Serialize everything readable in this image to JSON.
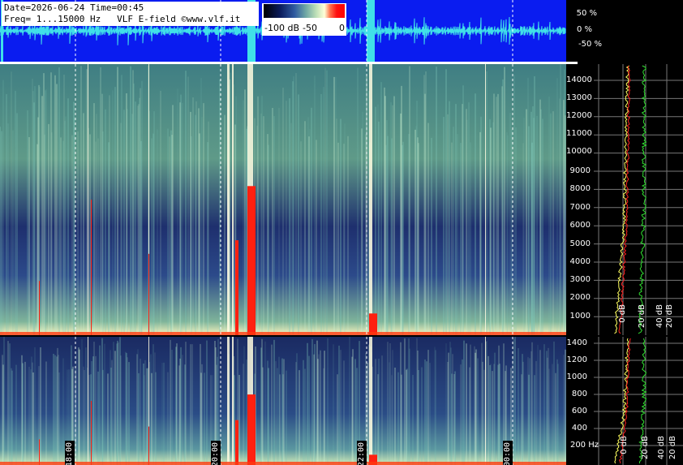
{
  "header": {
    "line1": "Date=2026-06-24 Time=00:45",
    "line2": "Freq= 1...15000 Hz   VLF E-field ©www.vlf.it"
  },
  "colorbar": {
    "labels": [
      "-100 dB",
      "-50",
      "0"
    ]
  },
  "waveform_axis": {
    "labels": [
      "50 %",
      "0 %",
      "-50 %"
    ]
  },
  "spectrogram_top": {
    "freq_labels": [
      "14000",
      "13000",
      "12000",
      "11000",
      "10000",
      "9000",
      "8000",
      "7000",
      "6000",
      "5000",
      "4000",
      "3000",
      "2000",
      "1000"
    ],
    "db_labels": [
      "0 dB",
      "20 dB",
      "40 dB",
      "20 dB"
    ]
  },
  "spectrogram_bottom": {
    "freq_labels": [
      "1400",
      "1200",
      "1000",
      "800",
      "600",
      "400",
      "200 Hz"
    ],
    "db_labels": [
      "0 dB",
      "20 dB",
      "40 dB",
      "20 dB"
    ]
  },
  "time_marks": [
    "18:00",
    "20:00",
    "22:00",
    "00:00"
  ],
  "colors": {
    "wave_bg": "#0a1cf0",
    "wave_line": "#40e0e8",
    "avg_red": "#ff2020",
    "avg_yellow": "#ffff60",
    "avg_green": "#30e030"
  }
}
